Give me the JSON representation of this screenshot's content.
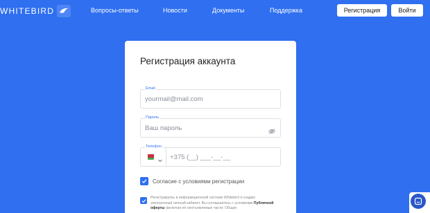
{
  "header": {
    "logo_text": "WHITEBIRD",
    "nav": [
      "Вопросы-ответы",
      "Новости",
      "Документы",
      "Поддержка"
    ],
    "register_label": "Регистрация",
    "login_label": "Войти"
  },
  "form": {
    "title": "Регистрация аккаунта",
    "email": {
      "label": "Email",
      "placeholder": "yourmail@mail.com"
    },
    "password": {
      "label": "Пароль",
      "placeholder": "Ваш пароль"
    },
    "phone": {
      "label": "Телефон",
      "placeholder": "+375 (__) ___-__-__"
    },
    "consent_label": "Согласие с условиями регистрации",
    "terms_text_1": "Регистрируясь в информационной системе Whitebird я создаю электронный личный кабинет. Вы соглашаетесь с условиями",
    "terms_link": "Публичной оферты",
    "terms_text_2": "(включая её неотъемлемые части: Общие"
  },
  "colors": {
    "accent": "#2f6ff0",
    "background": "#2f6ff0"
  },
  "icons": [
    "logo-bird-icon",
    "eye-off-icon",
    "belarus-flag-icon",
    "chevron-down-icon",
    "check-icon",
    "chat-icon"
  ]
}
